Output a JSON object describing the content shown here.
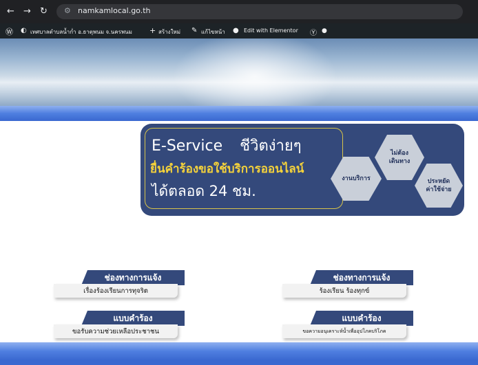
{
  "browser": {
    "url": "namkamlocal.go.th"
  },
  "adminbar": {
    "site_name": "เทศบาลตำบลน้ำก่ำ อ.ธาตุพนม จ.นครพนม",
    "new_label": "สร้างใหม่",
    "edit_label": "แก้ไขหน้า",
    "elementor_label": "Edit with Elementor"
  },
  "banner": {
    "line1a": "E-Service",
    "line1b": "ชีวิตง่ายๆ",
    "line2": "ยื่นคำร้องขอใช้บริการออนไลน์",
    "line3": "ได้ตลอด 24 ชม.",
    "hex_service": "งานบริการ",
    "hex_no_travel_1": "ไม่ต้อง",
    "hex_no_travel_2": "เดินทาง",
    "hex_save_1": "ประหยัด",
    "hex_save_2": "ค่าใช้จ่าย"
  },
  "channels": [
    {
      "title": "ช่องทางการแจ้ง",
      "subtitle": "เรื่องร้องเรียนการทุจริต"
    },
    {
      "title": "ช่องทางการแจ้ง",
      "subtitle": "ร้องเรียน ร้องทุกข์"
    },
    {
      "title": "แบบคำร้อง",
      "subtitle": "ขอรับความช่วยเหลือประชาชน"
    },
    {
      "title": "แบบคำร้อง",
      "subtitle": "ขอความอนุเคราะห์น้ำเพื่ออุปโภคบริโภค"
    }
  ],
  "colors": {
    "navy": "#34497b",
    "gold": "#f6d33a",
    "blue_bar": "#4f7fe0"
  }
}
